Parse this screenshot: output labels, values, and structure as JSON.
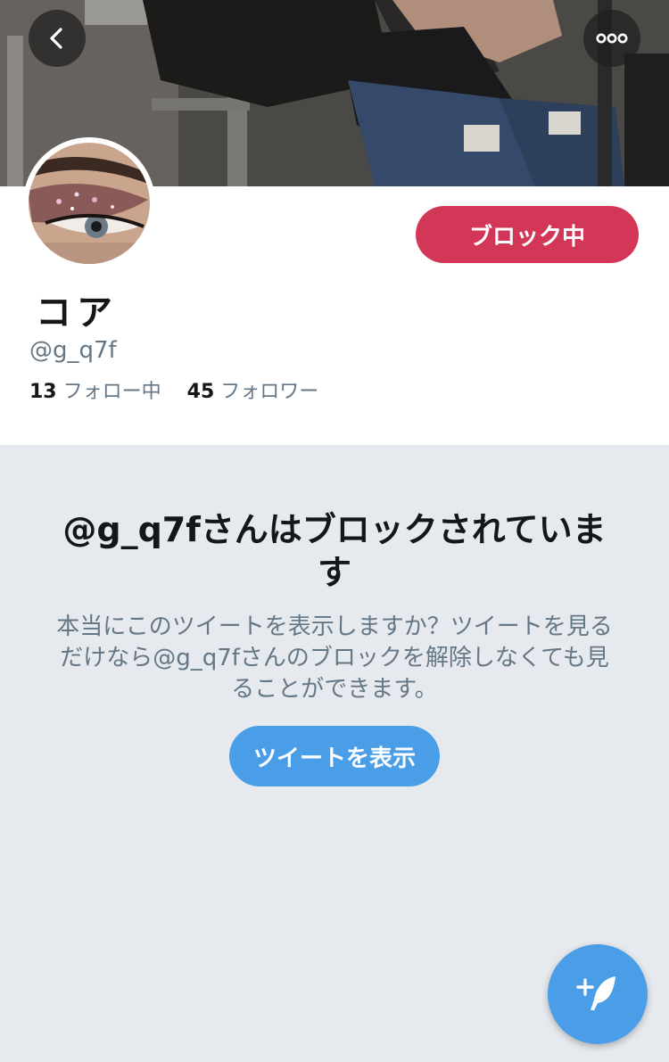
{
  "colors": {
    "block_button": "#d33758",
    "primary_blue": "#4a9ee8",
    "secondary_text": "#657786",
    "primary_text": "#14171a",
    "page_background": "#e6e9ed"
  },
  "header": {
    "back_icon": "chevron-left-icon",
    "more_icon": "more-dots-icon"
  },
  "profile": {
    "block_button_label": "ブロック中",
    "display_name": "コア",
    "handle": "@g_q7f",
    "following_count": "13",
    "following_label": "フォロー中",
    "followers_count": "45",
    "followers_label": "フォロワー"
  },
  "blocked_notice": {
    "title": "@g_q7fさんはブロックされています",
    "description": "本当にこのツイートを表示しますか？ツイートを見るだけなら@g_q7fさんのブロックを解除しなくても見ることができます。",
    "button_label": "ツイートを表示"
  },
  "fab": {
    "icon": "compose-tweet-icon"
  }
}
